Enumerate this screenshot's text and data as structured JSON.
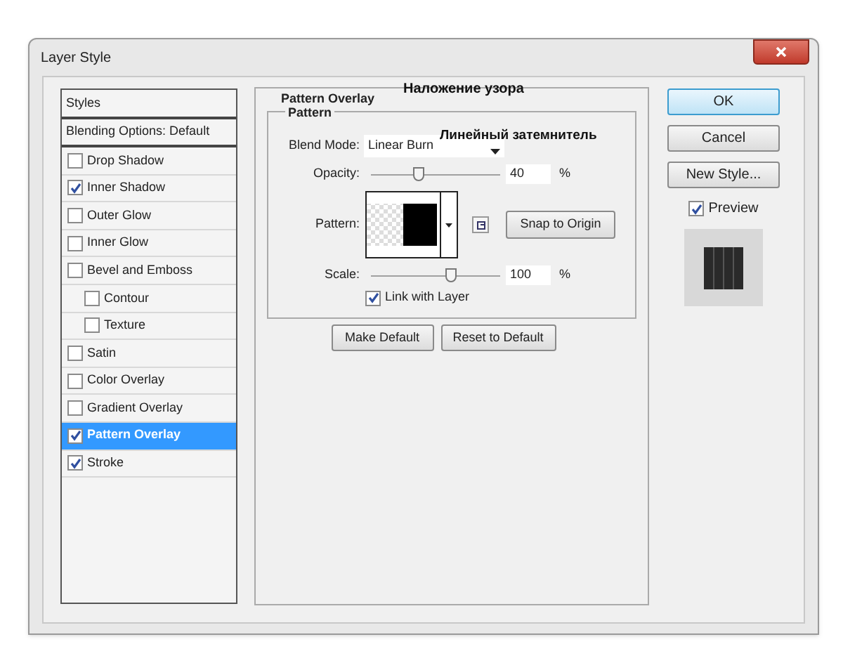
{
  "window": {
    "title": "Layer Style"
  },
  "styles_list": {
    "header": "Styles",
    "items": [
      {
        "kind": "header",
        "label": "Blending Options: Default",
        "selected": false
      },
      {
        "kind": "checkbox",
        "label": "Drop Shadow",
        "checked": false,
        "selected": false
      },
      {
        "kind": "checkbox",
        "label": "Inner Shadow",
        "checked": true,
        "selected": false
      },
      {
        "kind": "checkbox",
        "label": "Outer Glow",
        "checked": false,
        "selected": false
      },
      {
        "kind": "checkbox",
        "label": "Inner Glow",
        "checked": false,
        "selected": false
      },
      {
        "kind": "checkbox",
        "label": "Bevel and Emboss",
        "checked": false,
        "selected": false,
        "children": [
          {
            "kind": "checkbox",
            "label": "Contour",
            "checked": false,
            "selected": false
          },
          {
            "kind": "checkbox",
            "label": "Texture",
            "checked": false,
            "selected": false
          }
        ]
      },
      {
        "kind": "checkbox",
        "label": "Satin",
        "checked": false,
        "selected": false
      },
      {
        "kind": "checkbox",
        "label": "Color Overlay",
        "checked": false,
        "selected": false
      },
      {
        "kind": "checkbox",
        "label": "Gradient Overlay",
        "checked": false,
        "selected": false
      },
      {
        "kind": "checkbox",
        "label": "Pattern Overlay",
        "checked": true,
        "selected": true
      },
      {
        "kind": "checkbox",
        "label": "Stroke",
        "checked": true,
        "selected": false
      }
    ]
  },
  "panel": {
    "title": "Pattern Overlay",
    "annotation": "Наложение узора",
    "group": {
      "title": "Pattern",
      "blend_mode": {
        "label": "Blend Mode:",
        "value": "Linear Burn",
        "annotation": "Линейный затемнитель"
      },
      "opacity": {
        "label": "Opacity:",
        "level": 0.37,
        "value": "40",
        "unit": "%"
      },
      "pattern": {
        "label": "Pattern:",
        "snap_button": "Snap to Origin"
      },
      "scale": {
        "label": "Scale:",
        "level": 0.62,
        "value": "100",
        "unit": "%"
      },
      "link_with_layer": {
        "label": "Link with Layer",
        "checked": true
      }
    },
    "buttons": [
      "Make Default",
      "Reset to Default"
    ]
  },
  "side": {
    "ok": "OK",
    "cancel": "Cancel",
    "new_style": "New Style...",
    "preview": {
      "label": "Preview",
      "checked": true
    }
  }
}
